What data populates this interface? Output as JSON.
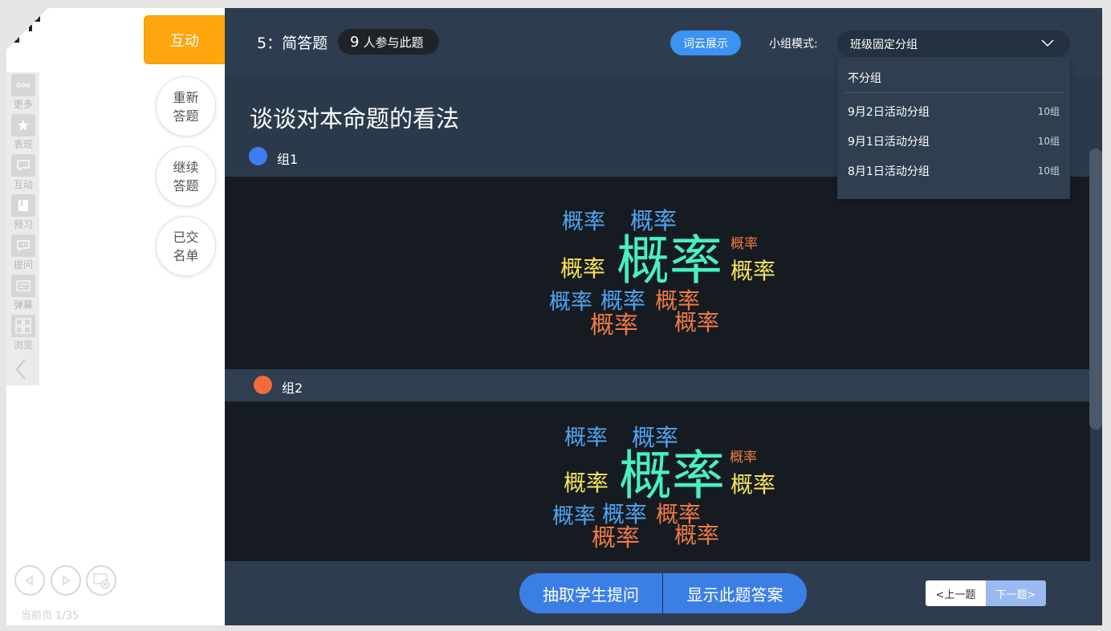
{
  "left_panel": {
    "tools": [
      {
        "label": "更多",
        "icon": "more-icon"
      },
      {
        "label": "表现",
        "icon": "star-icon"
      },
      {
        "label": "互动",
        "icon": "chat-icon"
      },
      {
        "label": "预习",
        "icon": "book-icon"
      },
      {
        "label": "提问",
        "icon": "question-chat-icon"
      },
      {
        "label": "弹幕",
        "icon": "barrage-icon"
      },
      {
        "label": "浏览",
        "icon": "grid-icon"
      }
    ],
    "page_indicator": "当前页 1/35"
  },
  "actions": {
    "interact_tab": "互动",
    "reanswer": "重新答题",
    "continue": "继续答题",
    "submitted_list": "已交名单"
  },
  "header": {
    "question_title": "5：简答题",
    "participant_count": "9",
    "participant_text": "人参与此题",
    "word_cloud_button": "词云展示",
    "group_mode_label": "小组模式:",
    "group_mode_selected": "班级固定分组"
  },
  "dropdown": {
    "none_option": "不分组",
    "options": [
      {
        "label": "9月2日活动分组",
        "count": "10组"
      },
      {
        "label": "9月1日活动分组",
        "count": "10组"
      },
      {
        "label": "8月1日活动分组",
        "count": "10组"
      }
    ]
  },
  "content": {
    "question_text": "谈谈对本命题的看法",
    "groups": [
      {
        "name": "组1",
        "dot_color": "#3e7cf0",
        "words": [
          "概率",
          "概率",
          "概率",
          "概率",
          "概率",
          "概率",
          "概率",
          "概率",
          "概率",
          "概率",
          "概率"
        ]
      },
      {
        "name": "组2",
        "dot_color": "#f26b3a",
        "words": [
          "概率",
          "概率",
          "概率",
          "概率",
          "概率",
          "概率",
          "概率",
          "概率",
          "概率",
          "概率",
          "概率"
        ]
      }
    ]
  },
  "colors": {
    "blue_word": "#4fa4f0",
    "green_word": "#48f0c4",
    "yellow_word": "#f5e35a",
    "orange_word": "#ee7a45"
  },
  "footer": {
    "pick_student": "抽取学生提问",
    "show_answer": "显示此题答案",
    "prev": "<上一题",
    "next": "下一题>"
  }
}
